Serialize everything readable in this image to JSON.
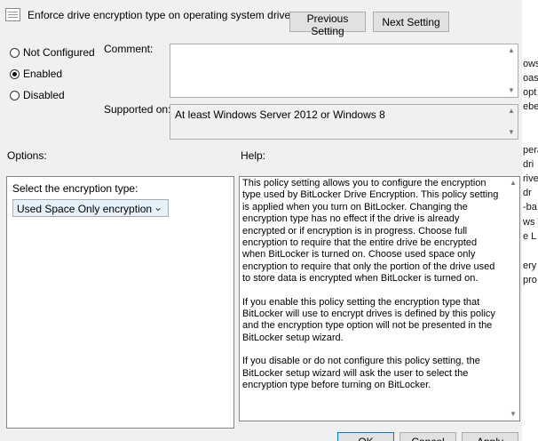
{
  "window": {
    "title": "Enforce drive encryption type on operating system drives"
  },
  "nav": {
    "previous_label": "Previous Setting",
    "next_label": "Next Setting"
  },
  "state": {
    "options": [
      "Not Configured",
      "Enabled",
      "Disabled"
    ],
    "selected": "Enabled"
  },
  "comment": {
    "label": "Comment:",
    "value": ""
  },
  "supported": {
    "label": "Supported on:",
    "value": "At least Windows Server 2012 or Windows 8"
  },
  "options_section": {
    "label": "Options:",
    "select_label": "Select the encryption type:",
    "select_value": "Used Space Only encryption"
  },
  "help": {
    "label": "Help:",
    "paragraphs": [
      "This policy setting allows you to configure the encryption type used by BitLocker Drive Encryption. This policy setting is applied when you turn on BitLocker. Changing the encryption type has no effect if the drive is already encrypted or if encryption is in progress. Choose full encryption to require that the entire drive be encrypted when BitLocker is turned on. Choose used space only encryption to require that only the portion of the drive used to store data is encrypted when BitLocker is turned on.",
      "If you enable this policy setting the encryption type that BitLocker will use to encrypt drives is defined by this policy and the encryption type option will not be presented in the BitLocker setup wizard.",
      "If you disable or do not configure this policy setting, the BitLocker setup wizard will ask the user to select the encryption type before turning on BitLocker."
    ]
  },
  "footer": {
    "ok_label": "OK",
    "cancel_label": "Cancel",
    "apply_label": "Apply"
  },
  "background_fragments": [
    "ows",
    "oas",
    "opt",
    "ebe",
    "pera",
    "dri",
    "rive",
    "dr",
    "-ba",
    "ws V",
    "e L",
    "ery",
    "pro"
  ]
}
